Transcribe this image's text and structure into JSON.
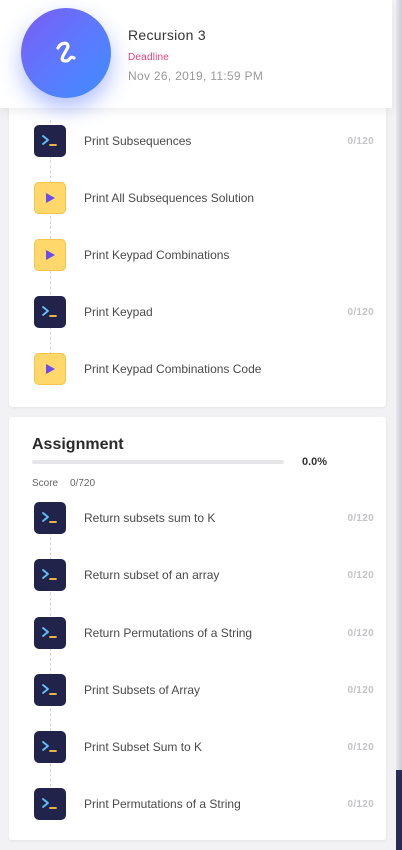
{
  "header": {
    "title": "Recursion 3",
    "deadline_label": "Deadline",
    "deadline_date": "Nov 26, 2019, 11:59 PM",
    "logo_icon": "squiggle-icon"
  },
  "content_items": [
    {
      "label": "Print Subsequences",
      "type": "code",
      "score": "0/120"
    },
    {
      "label": "Print All Subsequences Solution",
      "type": "video",
      "score": ""
    },
    {
      "label": "Print Keypad Combinations",
      "type": "video",
      "score": ""
    },
    {
      "label": "Print Keypad",
      "type": "code",
      "score": "0/120"
    },
    {
      "label": "Print Keypad Combinations Code",
      "type": "video",
      "score": ""
    }
  ],
  "assignment": {
    "title": "Assignment",
    "progress_percent": "0.0%",
    "progress_fraction": 0,
    "score_label": "Score",
    "score_value": "0/720",
    "items": [
      {
        "label": "Return subsets sum to K",
        "type": "code",
        "score": "0/120"
      },
      {
        "label": "Return subset of an array",
        "type": "code",
        "score": "0/120"
      },
      {
        "label": "Return Permutations of a String",
        "type": "code",
        "score": "0/120"
      },
      {
        "label": "Print Subsets of Array",
        "type": "code",
        "score": "0/120"
      },
      {
        "label": "Print Subset Sum to K",
        "type": "code",
        "score": "0/120"
      },
      {
        "label": "Print Permutations of a String",
        "type": "code",
        "score": "0/120"
      }
    ]
  },
  "colors": {
    "accent": "#5a7bff",
    "deadline": "#e5407a",
    "code_icon_bg": "#22234a",
    "video_icon_bg": "#ffd76a",
    "video_play": "#6a4cf0"
  }
}
